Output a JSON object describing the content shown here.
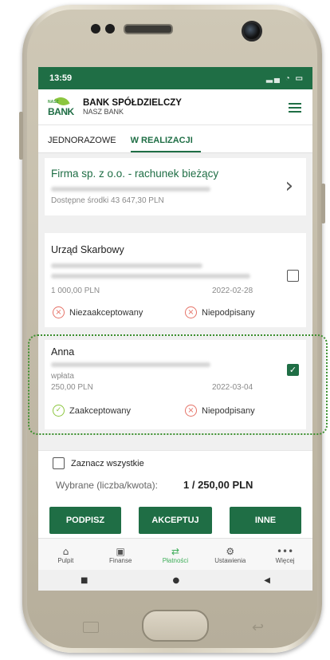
{
  "status_bar": {
    "time": "13:59"
  },
  "header": {
    "bank_name": "BANK SPÓŁDZIELCZY",
    "bank_sub": "NASZ BANK",
    "logo_small": "NASZ",
    "logo_big": "BANK"
  },
  "tabs": [
    {
      "label": "JEDNORAZOWE"
    },
    {
      "label": "W REALIZACJI"
    }
  ],
  "account": {
    "name": "Firma sp. z o.o. - rachunek bieżący",
    "balance": "Dostępne środki 43 647,30 PLN"
  },
  "payments": [
    {
      "title": "Urząd Skarbowy",
      "amount": "1 000,00 PLN",
      "date": "2022-02-28",
      "status_accept": "Niezaakceptowany",
      "status_sign": "Niepodpisany",
      "checked": false
    },
    {
      "title": "Anna",
      "description": "wpłata",
      "amount": "250,00 PLN",
      "date": "2022-03-04",
      "status_accept": "Zaakceptowany",
      "status_sign": "Niepodpisany",
      "checked": true
    }
  ],
  "selection": {
    "select_all": "Zaznacz wszystkie",
    "summary_label": "Wybrane (liczba/kwota):",
    "summary_value": "1 / 250,00 PLN"
  },
  "actions": {
    "sign": "PODPISZ",
    "accept": "AKCEPTUJ",
    "other": "INNE"
  },
  "bottom_nav": [
    {
      "label": "Pulpit",
      "icon": "home-icon"
    },
    {
      "label": "Finanse",
      "icon": "wallet-icon"
    },
    {
      "label": "Płatności",
      "icon": "transfer-icon",
      "active": true
    },
    {
      "label": "Ustawienia",
      "icon": "gear-icon"
    },
    {
      "label": "Więcej",
      "icon": "more-icon"
    }
  ],
  "colors": {
    "brand": "#1f6e45",
    "accent": "#8cc63f",
    "error": "#e57368",
    "highlight": "#3b8f2e"
  }
}
